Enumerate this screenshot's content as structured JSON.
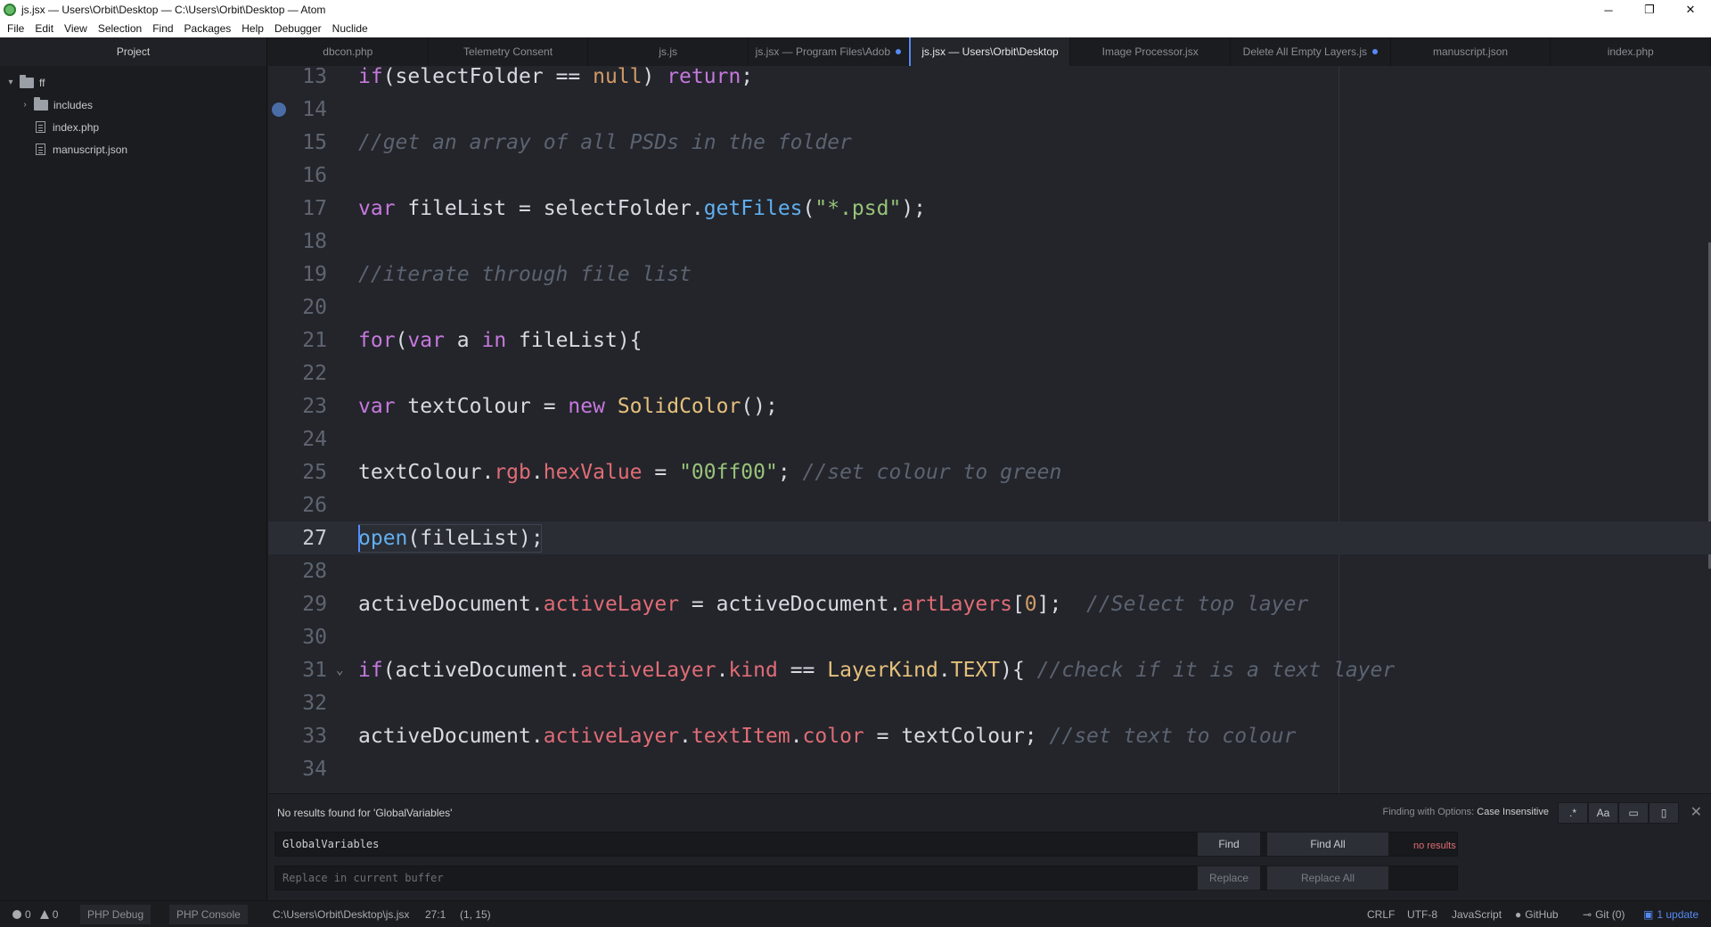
{
  "window": {
    "title": "js.jsx — Users\\Orbit\\Desktop — C:\\Users\\Orbit\\Desktop — Atom",
    "controls": [
      "─",
      "❐",
      "✕"
    ]
  },
  "menu": [
    "File",
    "Edit",
    "View",
    "Selection",
    "Find",
    "Packages",
    "Help",
    "Debugger",
    "Nuclide"
  ],
  "tree": {
    "header": "Project",
    "root": "ff",
    "folders": [
      "includes"
    ],
    "files": [
      "index.php",
      "manuscript.json"
    ]
  },
  "tabs": [
    {
      "label": "dbcon.php",
      "modified": false,
      "active": false
    },
    {
      "label": "Telemetry Consent",
      "modified": false,
      "active": false
    },
    {
      "label": "js.js",
      "modified": false,
      "active": false
    },
    {
      "label": "js.jsx — Program Files\\Adob",
      "modified": true,
      "active": false
    },
    {
      "label": "js.jsx — Users\\Orbit\\Desktop",
      "modified": false,
      "active": true
    },
    {
      "label": "Image Processor.jsx",
      "modified": false,
      "active": false
    },
    {
      "label": "Delete All Empty Layers.js",
      "modified": true,
      "active": false
    },
    {
      "label": "manuscript.json",
      "modified": false,
      "active": false
    },
    {
      "label": "index.php",
      "modified": false,
      "active": false
    }
  ],
  "editor": {
    "cursor_line": 27,
    "breakpoint_line": 14,
    "fold_line": 31,
    "lines": [
      {
        "n": "13",
        "tokens": [
          [
            "kw",
            "if"
          ],
          [
            "",
            "(selectFolder == "
          ],
          [
            "nu",
            "null"
          ],
          [
            "",
            ") "
          ],
          [
            "kw",
            "return"
          ],
          [
            "",
            ";"
          ]
        ]
      },
      {
        "n": "14",
        "tokens": []
      },
      {
        "n": "15",
        "tokens": [
          [
            "cm",
            "//get an array of all PSDs in the folder"
          ]
        ]
      },
      {
        "n": "16",
        "tokens": []
      },
      {
        "n": "17",
        "tokens": [
          [
            "kw",
            "var"
          ],
          [
            "",
            " fileList = selectFolder."
          ],
          [
            "fn",
            "getFiles"
          ],
          [
            "",
            "("
          ],
          [
            "st",
            "\"*.psd\""
          ],
          [
            "",
            ");"
          ]
        ]
      },
      {
        "n": "18",
        "tokens": []
      },
      {
        "n": "19",
        "tokens": [
          [
            "cm",
            "//iterate through file list"
          ]
        ]
      },
      {
        "n": "20",
        "tokens": []
      },
      {
        "n": "21",
        "tokens": [
          [
            "kw",
            "for"
          ],
          [
            "",
            "("
          ],
          [
            "kw",
            "var"
          ],
          [
            "",
            " a "
          ],
          [
            "kw",
            "in"
          ],
          [
            "",
            " fileList){"
          ]
        ]
      },
      {
        "n": "22",
        "tokens": []
      },
      {
        "n": "23",
        "tokens": [
          [
            "kw",
            "var"
          ],
          [
            "",
            " textColour = "
          ],
          [
            "kw",
            "new"
          ],
          [
            "",
            " "
          ],
          [
            "cl",
            "SolidColor"
          ],
          [
            "",
            "();"
          ]
        ]
      },
      {
        "n": "24",
        "tokens": []
      },
      {
        "n": "25",
        "tokens": [
          [
            "",
            "textColour."
          ],
          [
            "pr",
            "rgb"
          ],
          [
            "",
            "."
          ],
          [
            "pr",
            "hexValue"
          ],
          [
            "",
            " = "
          ],
          [
            "st",
            "\"00ff00\""
          ],
          [
            "",
            "; "
          ],
          [
            "cm",
            "//set colour to green"
          ]
        ]
      },
      {
        "n": "26",
        "tokens": []
      },
      {
        "n": "27",
        "tokens": [
          [
            "fn",
            "open"
          ],
          [
            "",
            "(fileList);"
          ]
        ]
      },
      {
        "n": "28",
        "tokens": []
      },
      {
        "n": "29",
        "tokens": [
          [
            "",
            "activeDocument."
          ],
          [
            "pr",
            "activeLayer"
          ],
          [
            "",
            " = activeDocument."
          ],
          [
            "pr",
            "artLayers"
          ],
          [
            "",
            "["
          ],
          [
            "nu",
            "0"
          ],
          [
            "",
            "];  "
          ],
          [
            "cm",
            "//Select top layer"
          ]
        ]
      },
      {
        "n": "30",
        "tokens": []
      },
      {
        "n": "31",
        "tokens": [
          [
            "kw",
            "if"
          ],
          [
            "",
            "(activeDocument."
          ],
          [
            "pr",
            "activeLayer"
          ],
          [
            "",
            "."
          ],
          [
            "pr",
            "kind"
          ],
          [
            "",
            " == "
          ],
          [
            "cl",
            "LayerKind"
          ],
          [
            "",
            "."
          ],
          [
            "cl",
            "TEXT"
          ],
          [
            "",
            "){ "
          ],
          [
            "cm",
            "//check if it is a text layer"
          ]
        ]
      },
      {
        "n": "32",
        "tokens": []
      },
      {
        "n": "33",
        "tokens": [
          [
            "",
            "activeDocument."
          ],
          [
            "pr",
            "activeLayer"
          ],
          [
            "",
            "."
          ],
          [
            "pr",
            "textItem"
          ],
          [
            "",
            "."
          ],
          [
            "pr",
            "color"
          ],
          [
            "",
            " = textColour; "
          ],
          [
            "cm",
            "//set text to colour"
          ]
        ]
      },
      {
        "n": "34",
        "tokens": []
      }
    ]
  },
  "find": {
    "message": "No results found for 'GlobalVariables'",
    "options_prefix": "Finding with Options:",
    "options_value": "Case Insensitive",
    "option_buttons": [
      ".*",
      "Aa",
      "▭",
      "▯"
    ],
    "close": "✕",
    "search_value": "GlobalVariables",
    "result_status": "no results",
    "replace_placeholder": "Replace in current buffer",
    "find_label": "Find",
    "find_all_label": "Find All",
    "replace_label": "Replace",
    "replace_all_label": "Replace All"
  },
  "status": {
    "errors": "0",
    "warnings": "0",
    "php_debug": "PHP Debug",
    "php_console": "PHP Console",
    "path": "C:\\Users\\Orbit\\Desktop\\js.jsx",
    "cursor_pos": "27:1",
    "selection": "(1, 15)",
    "line_ending": "CRLF",
    "encoding": "UTF-8",
    "grammar": "JavaScript",
    "github": "GitHub",
    "git": "Git (0)",
    "update": "1 update"
  }
}
